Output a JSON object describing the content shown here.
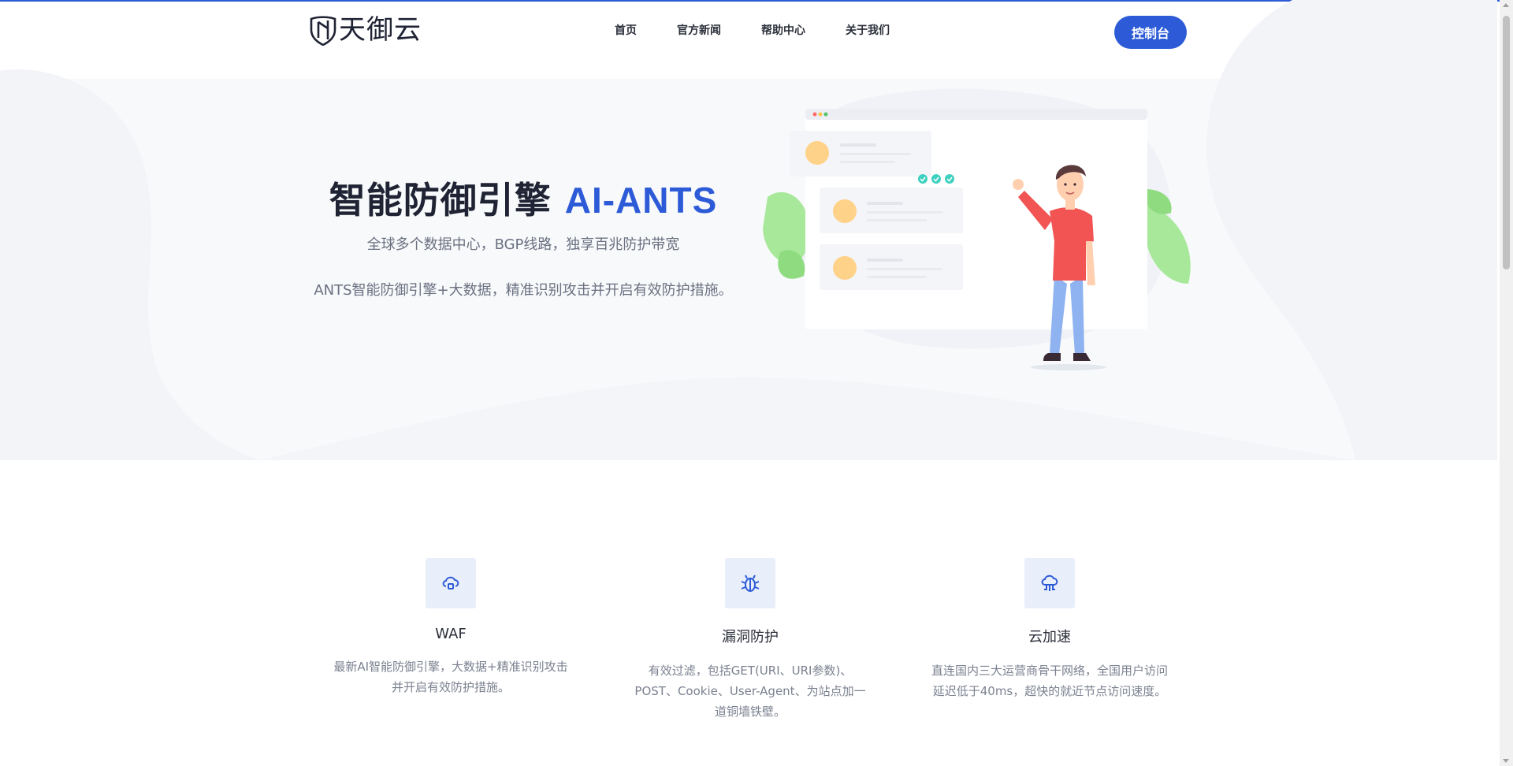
{
  "brand": {
    "logo_text": "天御云",
    "accent_color": "#2d5bd7"
  },
  "nav": {
    "items": [
      "首页",
      "官方新闻",
      "帮助中心",
      "关于我们"
    ]
  },
  "header": {
    "console_label": "控制台"
  },
  "hero": {
    "title_main": "智能防御引擎",
    "title_accent": "AI-ANTS",
    "subtitle": "全球多个数据中心，BGP线路，独享百兆防护带宽",
    "description": "ANTS智能防御引擎+大数据，精准识别攻击并开启有效防护措施。"
  },
  "features": [
    {
      "icon": "cloud-shield-icon",
      "title": "WAF",
      "desc": "最新AI智能防御引擎，大数据+精准识别攻击并开启有效防护措施。"
    },
    {
      "icon": "bug-icon",
      "title": "漏洞防护",
      "desc": "有效过滤，包括GET(URI、URI参数)、POST、Cookie、User-Agent、为站点加一道铜墙铁壁。"
    },
    {
      "icon": "cloud-network-icon",
      "title": "云加速",
      "desc": "直连国内三大运营商骨干网络，全国用户访问延迟低于40ms，超快的就近节点访问速度。"
    }
  ]
}
